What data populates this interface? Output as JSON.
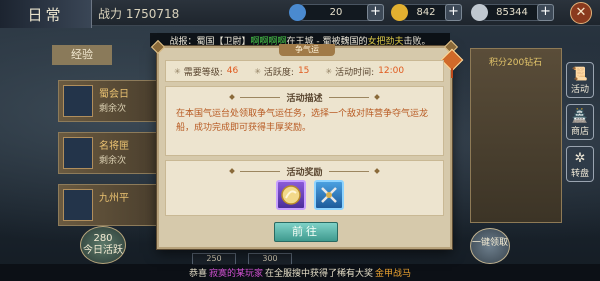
{
  "header": {
    "title": "日常",
    "power_label": "战力",
    "power_value": "1750718",
    "resources": [
      {
        "icon": "stamina-icon",
        "value": "20"
      },
      {
        "icon": "gold-coin-icon",
        "value": "842"
      },
      {
        "icon": "silver-coin-icon",
        "value": "85344"
      }
    ],
    "close_label": "✕"
  },
  "announcement": {
    "prefix": "战报：蜀国【卫尉】",
    "player": "啊啊啊啊",
    "mid": "在王城 - 蜀被魏国的",
    "enemy": "女把劲夫",
    "suffix": "击败。"
  },
  "background": {
    "tab_label": "经验",
    "items": [
      {
        "title": "蜀会日",
        "sub": "剩余次"
      },
      {
        "title": "名将匣",
        "sub": "剩余次"
      },
      {
        "title": "九州平",
        "sub": ""
      }
    ],
    "reward_hint": "积分200钻石",
    "side_buttons": [
      {
        "label": "活动",
        "icon": "scroll-icon"
      },
      {
        "label": "商店",
        "icon": "shop-icon"
      },
      {
        "label": "转盘",
        "icon": "wheel-icon"
      }
    ],
    "left_badge": {
      "value": "280",
      "label": "今日活跃"
    },
    "right_badge": {
      "label": "一键领取"
    },
    "scores": [
      "250",
      "300"
    ],
    "ticker": {
      "prefix": "恭喜",
      "player": "寂寞的某玩家",
      "mid": "在全服搜中获得了稀有大奖",
      "item": "金甲战马"
    }
  },
  "dialog": {
    "title": "争气运",
    "info": [
      {
        "label": "需要等级:",
        "value": "46"
      },
      {
        "label": "活跃度:",
        "value": "15"
      },
      {
        "label": "活动时间:",
        "value": "12:00"
      }
    ],
    "desc_heading": "活动描述",
    "desc_text": "在本国气运台处领取争气运任务，选择一个敌对阵营争夺气运龙船，成功完成即可获得丰厚奖励。",
    "reward_heading": "活动奖励",
    "rewards": [
      {
        "icon": "coin-reward-icon",
        "color": "#7a4fd0"
      },
      {
        "icon": "crossed-swords-icon",
        "color": "#2f78c0"
      }
    ],
    "go_label": "前往"
  }
}
